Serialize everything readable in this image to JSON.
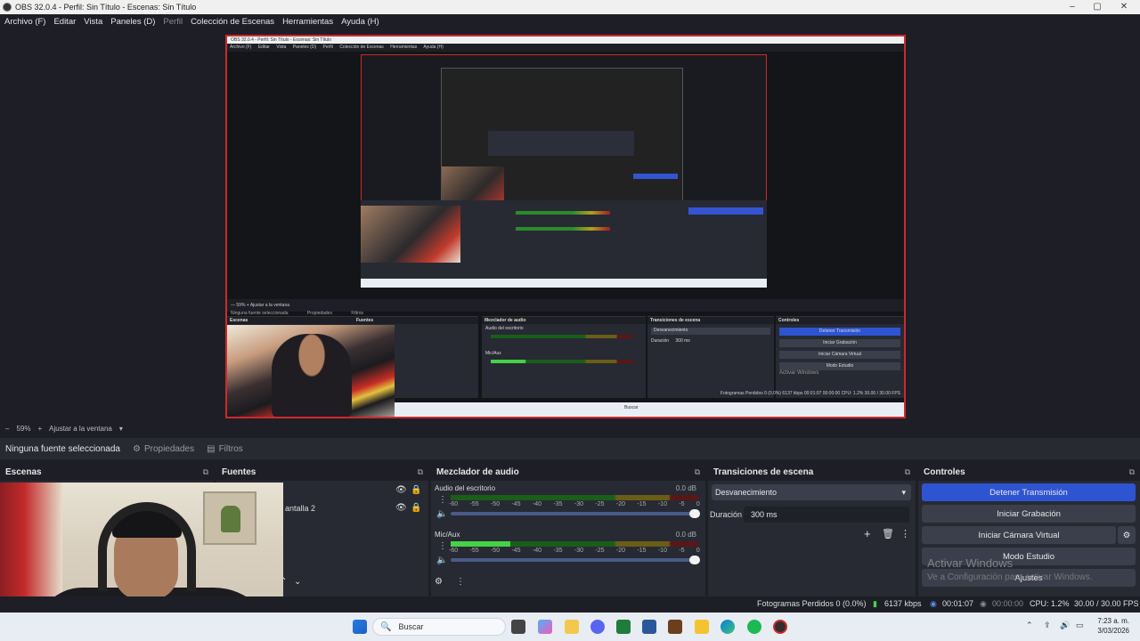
{
  "window": {
    "title": "OBS 32.0.4 - Perfil: Sin Título - Escenas: Sin Título",
    "controls": [
      "–",
      "▢",
      "✕"
    ]
  },
  "menu": [
    "Archivo (F)",
    "Editar",
    "Vista",
    "Paneles (D)",
    "Perfil",
    "Colección de Escenas",
    "Herramientas",
    "Ayuda (H)"
  ],
  "nested": {
    "title": "OBS 32.0.4 - Perfil: Sin Título - Escenas: Sin Título",
    "menu": [
      "Archivo (F)",
      "Editar",
      "Vista",
      "Paneles (D)",
      "Perfil",
      "Colección de Escenas",
      "Herramientas",
      "Ayuda (H)"
    ],
    "toolbar": "— 59%   +   Ajustar a la ventana",
    "context": "Ninguna fuente seleccionada",
    "props": "Propiedades",
    "filters": "Filtros",
    "docks": [
      "Escenas",
      "Fuentes",
      "Mezclador de audio",
      "Transiciones de escena",
      "Controles"
    ],
    "stream_btn": "Detener Transmisión",
    "ctl_btns": [
      "Iniciar Grabación",
      "Iniciar Cámara Virtual",
      "Modo Estudio",
      "Ajustes"
    ],
    "transition": "Desvanecimiento",
    "duration": "Duración",
    "duration_val": "300 ms",
    "tracks": [
      "Audio del escritorio",
      "Mic/Aux"
    ],
    "status": "Fotogramas Perdidos 0 (0.0%)   6137 kbps   00:01:07   00:00:00   CPU: 1.2%   30.00 / 30.00 FPS",
    "watermark": "Activar Windows",
    "search": "Buscar"
  },
  "zoom": {
    "minus": "–",
    "level": "59%",
    "plus": "+",
    "fit": "Ajustar a la ventana",
    "arrow": "▾"
  },
  "context": {
    "selection": "Ninguna fuente seleccionada",
    "properties": "Propiedades",
    "filters": "Filtros"
  },
  "docks": {
    "scenes": {
      "title": "Escenas"
    },
    "sources": {
      "title": "Fuentes",
      "items": [
        {
          "label": ""
        },
        {
          "label": "antalla 2"
        }
      ]
    },
    "mixer": {
      "title": "Mezclador de audio",
      "ticks": [
        "-60",
        "-55",
        "-50",
        "-45",
        "-40",
        "-35",
        "-30",
        "-25",
        "-20",
        "-15",
        "-10",
        "-5",
        "0"
      ],
      "tracks": [
        {
          "name": "Audio del escritorio",
          "db": "0.0 dB",
          "level": 0.0,
          "volume": 1.0
        },
        {
          "name": "Mic/Aux",
          "db": "0.0 dB",
          "level": 0.24,
          "volume": 1.0
        }
      ]
    },
    "transitions": {
      "title": "Transiciones de escena",
      "selected": "Desvanecimiento",
      "duration_label": "Duración",
      "duration_value": "300 ms"
    },
    "controls": {
      "title": "Controles",
      "stream": "Detener Transmisión",
      "record": "Iniciar Grabación",
      "virtual_cam": "Iniciar Cámara Virtual",
      "studio": "Modo Estudio",
      "settings": "Ajustes"
    }
  },
  "watermark": {
    "line1": "Activar Windows",
    "line2": "Ve a Configuración para activar Windows."
  },
  "status": {
    "dropped": "Fotogramas Perdidos 0 (0.0%)",
    "bitrate": "6137 kbps",
    "stream_time": "00:01:07",
    "rec_time": "00:00:00",
    "cpu": "CPU: 1.2%",
    "fps": "30.00 / 30.00 FPS"
  },
  "taskbar": {
    "search": "Buscar",
    "time": "7:23 a. m.",
    "date": "3/03/2026"
  },
  "colors": {
    "accent": "#2e54d2",
    "preview_border": "#cc2a2a",
    "meter_green": "#45d245"
  }
}
